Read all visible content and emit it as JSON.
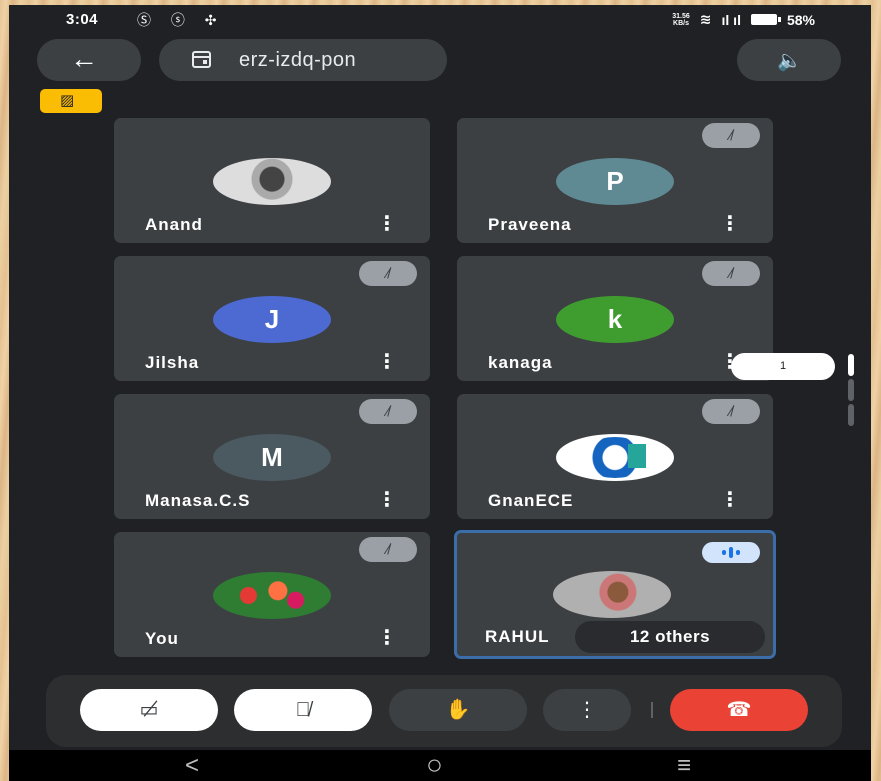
{
  "status": {
    "time": "3:04",
    "app_icons": "Ⓢ ⓢ ✣",
    "net_speed_value": "31.56",
    "net_speed_unit": "KB/s",
    "signal": "ıl ıl",
    "battery_pct": "58%"
  },
  "header": {
    "back_icon": "←",
    "meeting_code": "erz-izdq-pon",
    "speaker_icon": "🔈"
  },
  "camera_badge_icon": "▨",
  "tiles": [
    {
      "name": "Anand",
      "avatar_text": "",
      "muted": false
    },
    {
      "name": "Praveena",
      "avatar_text": "P",
      "muted": true
    },
    {
      "name": "Jilsha",
      "avatar_text": "J",
      "muted": true
    },
    {
      "name": "kanaga",
      "avatar_text": "k",
      "muted": true
    },
    {
      "name": "Manasa.C.S",
      "avatar_text": "M",
      "muted": true
    },
    {
      "name": "GnanECE",
      "avatar_text": "",
      "muted": true
    },
    {
      "name": "You",
      "avatar_text": "",
      "muted": true
    },
    {
      "name": "RAHUL",
      "avatar_text": "",
      "others": "12 others",
      "speaking": true
    }
  ],
  "avatar_colors": {
    "P": "#5f8a94",
    "J": "#4c6ad1",
    "k": "#3f9d2f",
    "M": "#4a5a60"
  },
  "page_indicator": "1",
  "controls": {
    "camera_icon": "▭̸",
    "mic_icon": "🎙̸",
    "hand_icon": "✋",
    "more_icon": "⋮",
    "end_icon": "☎"
  },
  "navbar": {
    "back": "<",
    "home": "○",
    "recents": "≡"
  }
}
